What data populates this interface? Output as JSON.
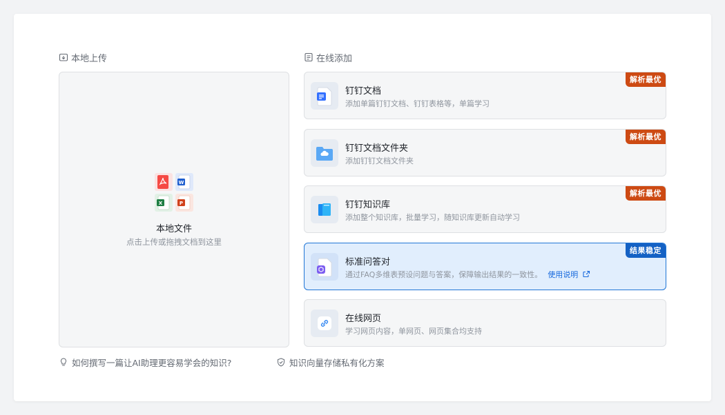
{
  "sections": {
    "local_title": "本地上传",
    "online_title": "在线添加"
  },
  "upload": {
    "title": "本地文件",
    "subtitle": "点击上传或拖拽文档到这里",
    "file_icons": [
      "pdf-icon",
      "word-icon",
      "excel-icon",
      "ppt-icon"
    ]
  },
  "options": [
    {
      "title": "钉钉文档",
      "desc": "添加单篇钉钉文档、钉钉表格等，单篇学习",
      "badge": "解析最优",
      "icon": "document-icon"
    },
    {
      "title": "钉钉文档文件夹",
      "desc": "添加钉钉文档文件夹",
      "badge": "解析最优",
      "icon": "folder-icon"
    },
    {
      "title": "钉钉知识库",
      "desc": "添加整个知识库，批量学习，随知识库更新自动学习",
      "badge": "解析最优",
      "icon": "book-icon"
    },
    {
      "title": "标准问答对",
      "desc": "通过FAQ多维表预设问题与答案，保障输出结果的一致性。",
      "link": "使用说明",
      "badge": "结果稳定",
      "icon": "faq-icon"
    },
    {
      "title": "在线网页",
      "desc": "学习网页内容，单网页、网页集合均支持",
      "icon": "link-icon"
    }
  ],
  "footer": {
    "help": "如何撰写一篇让AI助理更容易学会的知识?",
    "privacy": "知识向量存储私有化方案"
  },
  "colors": {
    "accent": "#1668dc",
    "badge_orange": "#cd4a13",
    "badge_blue": "#1461c4",
    "selected_bg": "#e1eefd"
  }
}
